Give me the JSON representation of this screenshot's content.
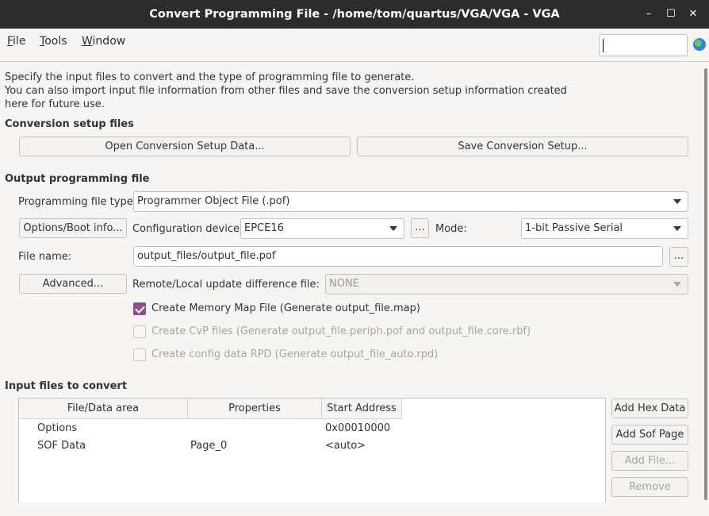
{
  "window": {
    "title": "Convert Programming File - /home/tom/quartus/VGA/VGA - VGA",
    "minimize": "–",
    "maximize": "☐",
    "close": "✕"
  },
  "menu": {
    "file_pre": "",
    "file_key": "F",
    "file_post": "ile",
    "tools_pre": "",
    "tools_key": "T",
    "tools_post": "ools",
    "window_pre": "",
    "window_key": "W",
    "window_post": "indow"
  },
  "search": {
    "value": "",
    "placeholder": ""
  },
  "description": {
    "line1": "Specify the input files to convert and the type of programming file to generate.",
    "line2": "You can also import input file information from other files and save the conversion setup information created here for future use."
  },
  "conversion_setup": {
    "heading": "Conversion setup files",
    "open_button": "Open Conversion Setup Data...",
    "save_button": "Save Conversion Setup..."
  },
  "output": {
    "heading": "Output programming file",
    "file_type_label": "Programming file type:",
    "file_type_value": "Programmer Object File (.pof)",
    "options_button": "Options/Boot info...",
    "config_device_label": "Configuration device:",
    "config_device_value": "EPCE16",
    "browse_device": "...",
    "mode_label": "Mode:",
    "mode_value": "1-bit Passive Serial",
    "file_name_label": "File name:",
    "file_name_value": "output_files/output_file.pof",
    "browse_file": "...",
    "advanced_button": "Advanced...",
    "remote_label": "Remote/Local update difference file:",
    "remote_value": "NONE",
    "chk_memory_map": "Create Memory Map File (Generate output_file.map)",
    "chk_memory_map_checked": true,
    "chk_cvp": "Create CvP files (Generate output_file.periph.pof and output_file.core.rbf)",
    "chk_rpd": "Create config data RPD (Generate output_file_auto.rpd)"
  },
  "input": {
    "heading": "Input files to convert",
    "columns": [
      "File/Data area",
      "Properties",
      "Start Address"
    ],
    "rows": [
      {
        "area": "Options",
        "properties": "",
        "address": "0x00010000"
      },
      {
        "area": "SOF Data",
        "properties": "Page_0",
        "address": "<auto>"
      }
    ],
    "add_hex": "Add Hex Data",
    "add_sof": "Add Sof Page",
    "add_file": "Add File...",
    "remove": "Remove"
  },
  "colors": {
    "titlebar": "#2c2c2c",
    "checkbox_accent": "#924d8b"
  }
}
